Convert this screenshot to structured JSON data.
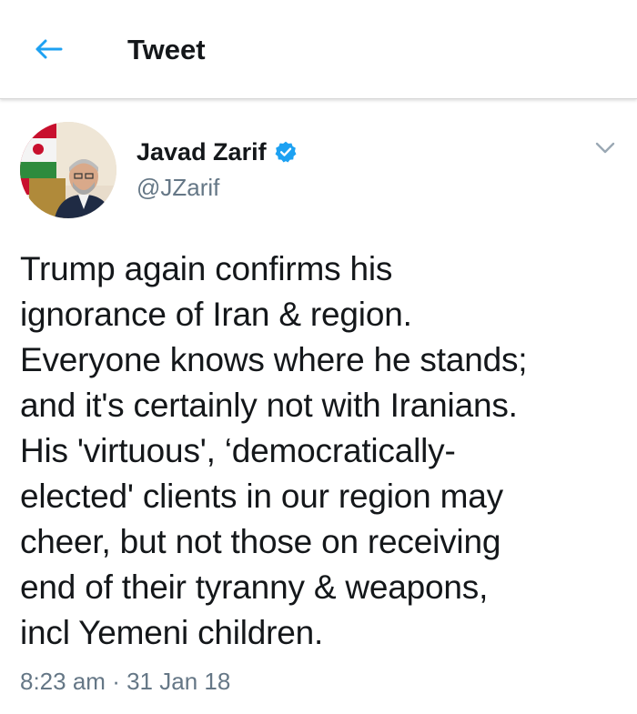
{
  "header": {
    "title": "Tweet",
    "back_icon": "back-arrow-icon",
    "accent_color": "#1da1f2"
  },
  "author": {
    "display_name": "Javad Zarif",
    "handle": "@JZarif",
    "verified": true,
    "verified_icon": "verified-badge-icon"
  },
  "tweet": {
    "lines": [
      "Trump again confirms his",
      "ignorance of Iran & region.",
      "Everyone knows where he stands;",
      "and it's certainly not with Iranians.",
      "His 'virtuous', ‘democratically-",
      "elected' clients in our region may",
      "cheer, but not those on receiving",
      "end of their tyranny & weapons,",
      "incl Yemeni children."
    ],
    "time": "8:23 am",
    "separator": "·",
    "date": "31 Jan 18"
  },
  "menu_icon": "chevron-down-icon"
}
